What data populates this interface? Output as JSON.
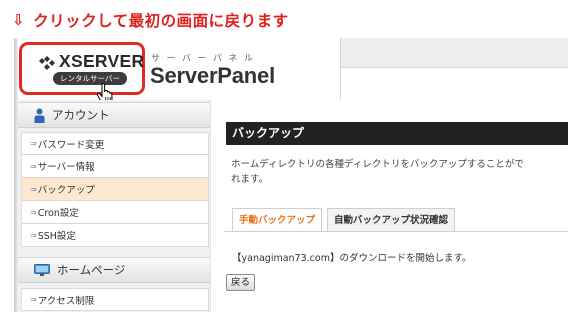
{
  "annotation": {
    "arrow": "⇩",
    "text": "クリックして最初の画面に戻ります",
    "color": "#e0201c"
  },
  "logo": {
    "text": "XSERVER",
    "pill": "レンタルサーバー",
    "highlight_color": "#e02a22"
  },
  "brand": {
    "subtitle": "サーバーパネル",
    "title": "ServerPanel"
  },
  "sidebar": {
    "sections": [
      {
        "title": "アカウント",
        "icon": "user-icon",
        "items": [
          {
            "label": "パスワード変更",
            "active": false
          },
          {
            "label": "サーバー情報",
            "active": false
          },
          {
            "label": "バックアップ",
            "active": true
          },
          {
            "label": "Cron設定",
            "active": false
          },
          {
            "label": "SSH設定",
            "active": false
          }
        ]
      },
      {
        "title": "ホームページ",
        "icon": "monitor-icon",
        "items": [
          {
            "label": "アクセス制限",
            "active": false
          }
        ]
      }
    ]
  },
  "main": {
    "title": "バックアップ",
    "description": "ホームディレクトリの各種ディレクトリをバックアップすることがで\nれます。",
    "tabs": [
      {
        "label": "手動バックアップ",
        "active": true
      },
      {
        "label": "自動バックアップ状況確認",
        "active": false
      }
    ],
    "download_message": "【yanagiman73.com】のダウンロードを開始します。",
    "back_button": "戻る"
  },
  "colors": {
    "active_tab": "#e8731a",
    "active_item_bg": "#fde7cf",
    "title_bar_bg": "#222222"
  }
}
